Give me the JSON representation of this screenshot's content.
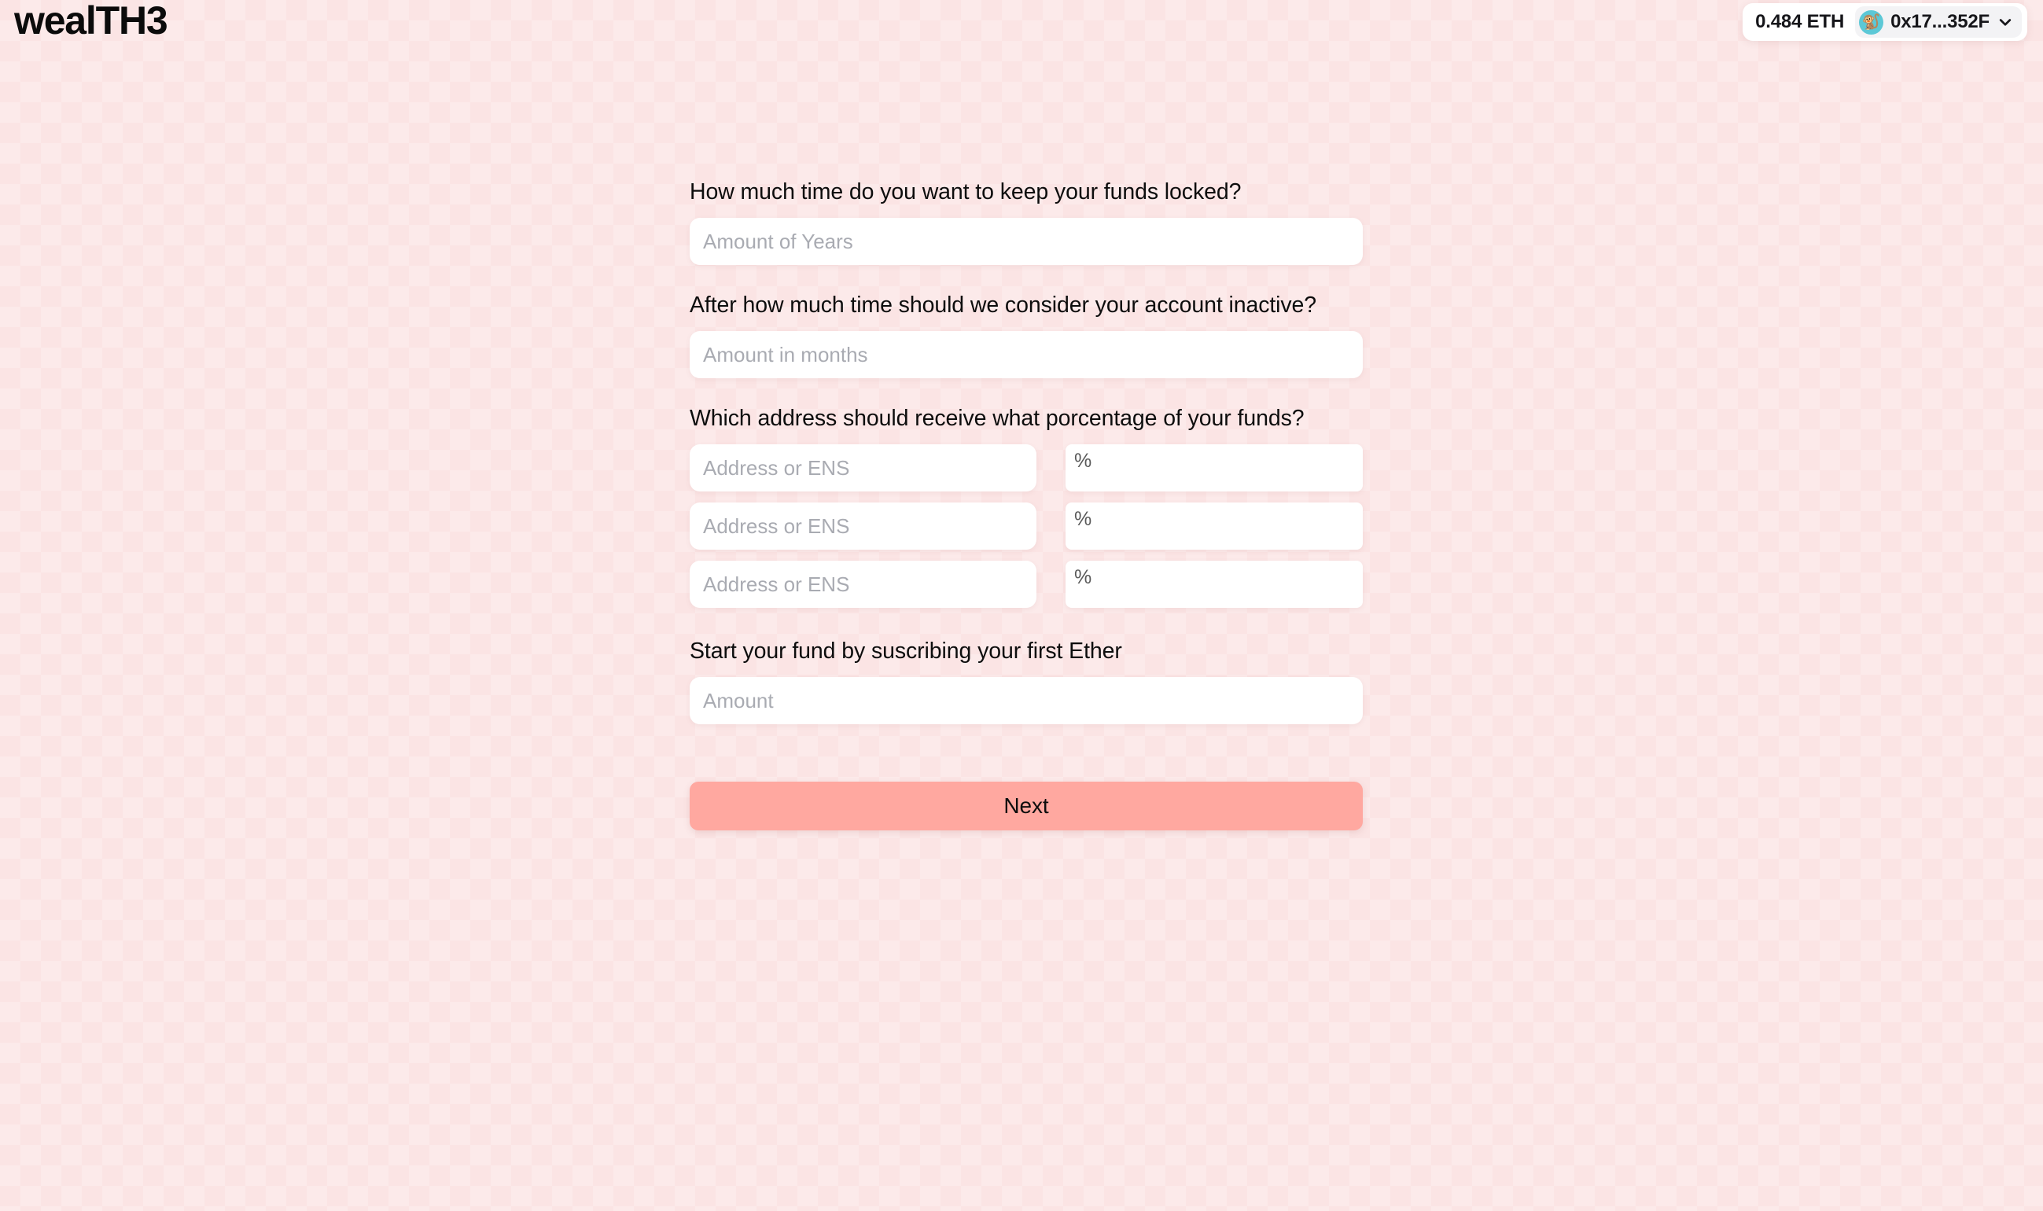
{
  "header": {
    "logo_lower": "weal",
    "logo_upper": "TH3",
    "wallet": {
      "balance": "0.484 ETH",
      "address": "0x17...352F",
      "avatar_emoji": "🐒",
      "avatar_icon_name": "monkey-avatar-icon",
      "chevron_icon_name": "chevron-down-icon",
      "avatar_bg_color": "#5cc8d6",
      "pill_bg_color": "#f3f3f5"
    }
  },
  "form": {
    "q1_label": "How much time do you want to keep your funds locked?",
    "q1_placeholder": "Amount of Years",
    "q2_label": "After how much time should we consider your account inactive?",
    "q2_placeholder": "Amount in months",
    "q3_label": "Which address should receive what porcentage of your funds?",
    "address_rows": [
      {
        "address_placeholder": "Address or ENS",
        "percent_symbol": "%",
        "percent_value": ""
      },
      {
        "address_placeholder": "Address or ENS",
        "percent_symbol": "%",
        "percent_value": ""
      },
      {
        "address_placeholder": "Address or ENS",
        "percent_symbol": "%",
        "percent_value": ""
      }
    ],
    "q4_label": "Start your fund by suscribing your first Ether",
    "q4_placeholder": "Amount",
    "submit_label": "Next"
  },
  "colors": {
    "page_background": "#fbe4e4",
    "input_background": "#ffffff",
    "placeholder": "#a9abb2",
    "text": "#0d0d0d",
    "accent_button": "#ffa8a0"
  }
}
